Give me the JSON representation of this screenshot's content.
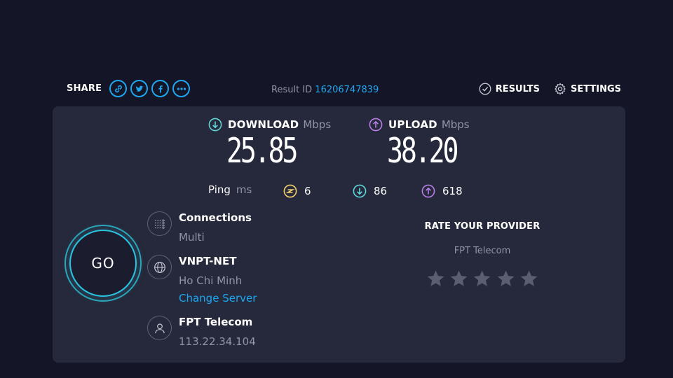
{
  "header": {
    "share_label": "SHARE",
    "share_icons": [
      "link-icon",
      "twitter-icon",
      "facebook-icon",
      "more-icon"
    ],
    "result_id_label": "Result ID",
    "result_id": "16206747839",
    "results_label": "RESULTS",
    "settings_label": "SETTINGS"
  },
  "download": {
    "title": "DOWNLOAD",
    "unit": "Mbps",
    "value": "25.85"
  },
  "upload": {
    "title": "UPLOAD",
    "unit": "Mbps",
    "value": "38.20"
  },
  "ping": {
    "label": "Ping",
    "unit": "ms",
    "idle": "6",
    "download": "86",
    "upload": "618"
  },
  "go_label": "GO",
  "connections": {
    "title": "Connections",
    "value": "Multi"
  },
  "server": {
    "name": "VNPT-NET",
    "location": "Ho Chi Minh",
    "change_label": "Change Server"
  },
  "isp": {
    "name": "FPT Telecom",
    "ip": "113.22.34.104"
  },
  "rate": {
    "title": "RATE YOUR PROVIDER",
    "provider": "FPT Telecom",
    "stars_total": 5,
    "stars_selected": 0
  },
  "colors": {
    "background": "#141526",
    "panel": "#26283b",
    "accent": "#1ea7f0",
    "download": "#5fd6d9",
    "upload": "#b77ee6",
    "idle_ping": "#f2d36b",
    "muted": "#9193a8",
    "star": "#5b5d70"
  }
}
